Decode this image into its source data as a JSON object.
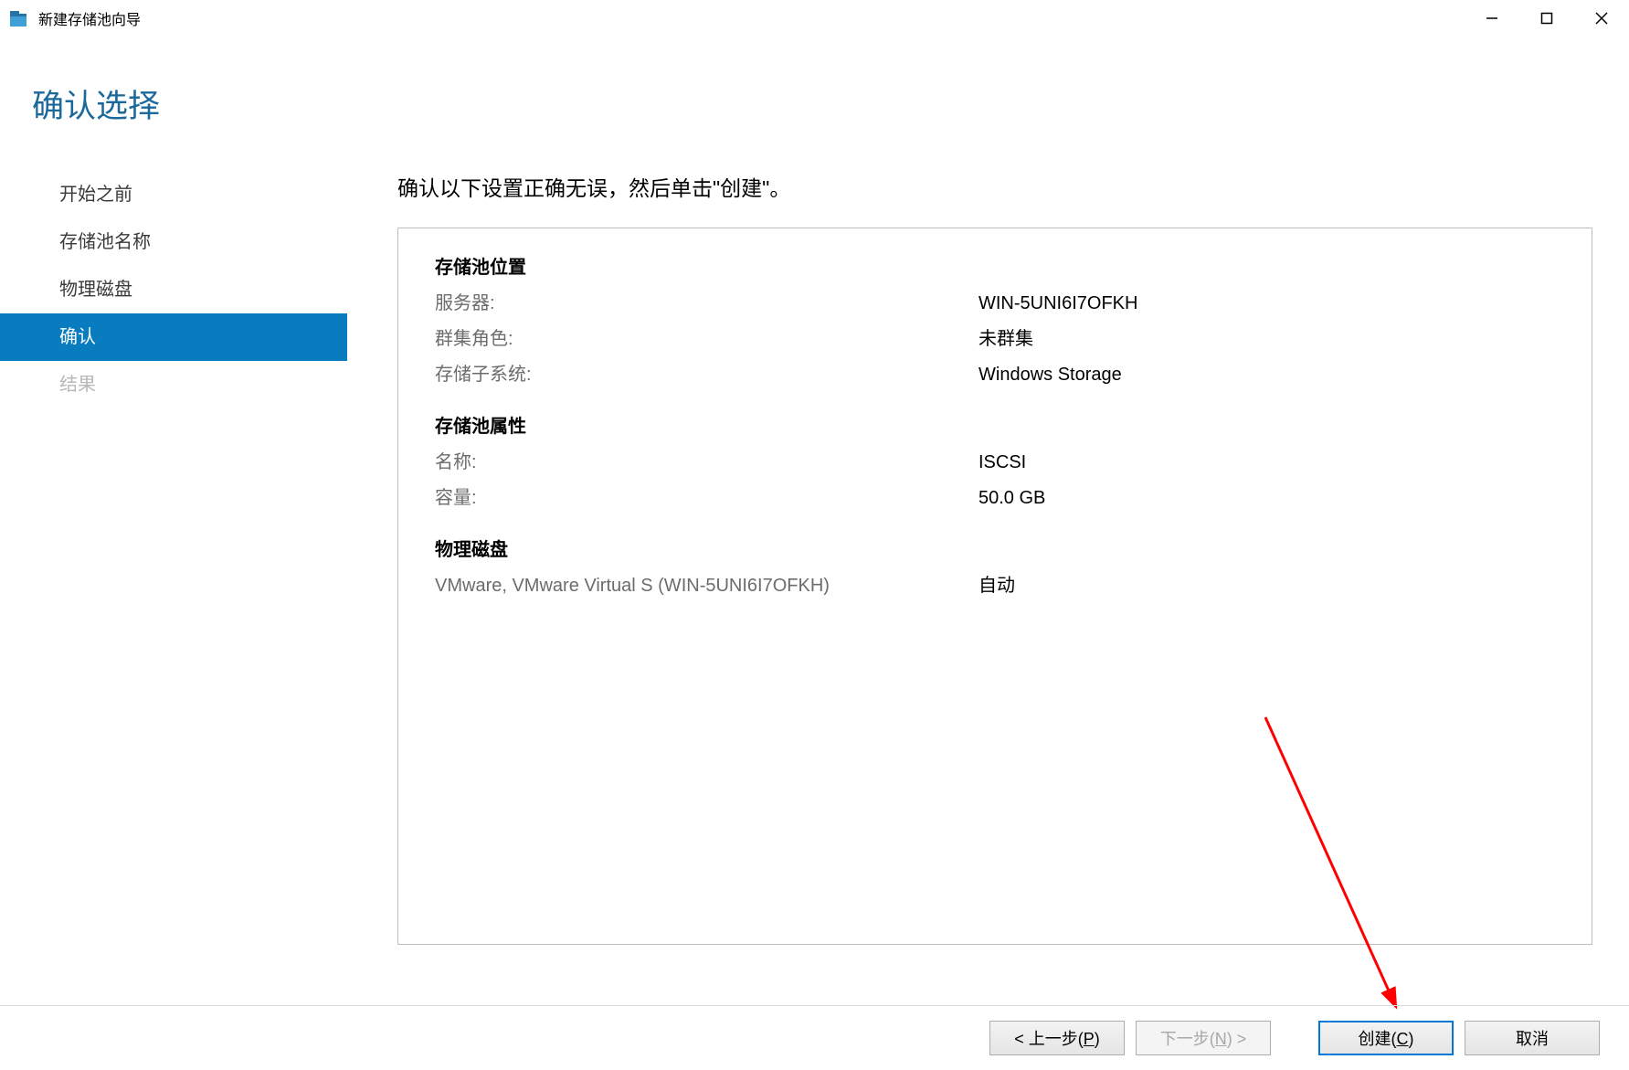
{
  "window": {
    "title": "新建存储池向导"
  },
  "heading": "确认选择",
  "sidebar": {
    "items": [
      {
        "label": "开始之前",
        "state": "normal"
      },
      {
        "label": "存储池名称",
        "state": "normal"
      },
      {
        "label": "物理磁盘",
        "state": "normal"
      },
      {
        "label": "确认",
        "state": "active"
      },
      {
        "label": "结果",
        "state": "disabled"
      }
    ]
  },
  "instruction": "确认以下设置正确无误，然后单击\"创建\"。",
  "sections": [
    {
      "title": "存储池位置",
      "rows": [
        {
          "label": "服务器:",
          "value": "WIN-5UNI6I7OFKH"
        },
        {
          "label": "群集角色:",
          "value": "未群集"
        },
        {
          "label": "存储子系统:",
          "value": "Windows Storage"
        }
      ]
    },
    {
      "title": "存储池属性",
      "rows": [
        {
          "label": "名称:",
          "value": "ISCSI"
        },
        {
          "label": "容量:",
          "value": "50.0 GB"
        }
      ]
    },
    {
      "title": "物理磁盘",
      "rows": [
        {
          "label": "VMware, VMware Virtual S (WIN-5UNI6I7OFKH)",
          "value": "自动"
        }
      ]
    }
  ],
  "footer": {
    "buttons": {
      "previous_prefix": "< 上一步(",
      "previous_u": "P",
      "previous_suffix": ")",
      "next_prefix": "下一步(",
      "next_u": "N",
      "next_suffix": ") >",
      "create_prefix": "创建(",
      "create_u": "C",
      "create_suffix": ")",
      "cancel": "取消"
    }
  }
}
